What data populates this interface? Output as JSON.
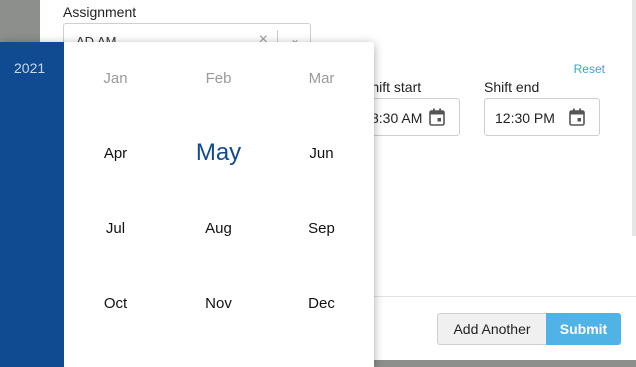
{
  "assignment": {
    "label": "Assignment",
    "value": "AD AM",
    "clear_icon": "×",
    "chevron_icon": "⌄"
  },
  "reset_label": "Reset",
  "shift_start": {
    "label": "Shift start",
    "value": "8:30 AM"
  },
  "shift_end": {
    "label": "Shift end",
    "value": "12:30 PM"
  },
  "footer": {
    "add_another": "Add Another",
    "submit": "Submit"
  },
  "picker": {
    "year": "2021",
    "months": [
      {
        "label": "Jan",
        "state": "dim"
      },
      {
        "label": "Feb",
        "state": "dim"
      },
      {
        "label": "Mar",
        "state": "dim"
      },
      {
        "label": "Apr",
        "state": "normal"
      },
      {
        "label": "May",
        "state": "selected"
      },
      {
        "label": "Jun",
        "state": "normal"
      },
      {
        "label": "Jul",
        "state": "normal"
      },
      {
        "label": "Aug",
        "state": "normal"
      },
      {
        "label": "Sep",
        "state": "normal"
      },
      {
        "label": "Oct",
        "state": "normal"
      },
      {
        "label": "Nov",
        "state": "normal"
      },
      {
        "label": "Dec",
        "state": "normal"
      }
    ]
  },
  "colors": {
    "year_bg": "#104a90",
    "accent": "#4fb3e6",
    "link": "#3aa3d8"
  }
}
